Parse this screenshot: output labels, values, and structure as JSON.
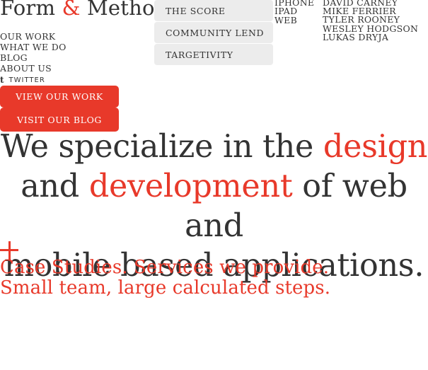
{
  "logo": {
    "part1": "Form ",
    "amp": "&",
    "part2": " Method"
  },
  "nav": {
    "items": [
      "OUR WORK",
      "WHAT WE DO",
      "BLOG",
      "ABOUT US"
    ],
    "twitter_label": "TWITTER",
    "twitter_icon": "twitter-icon"
  },
  "buttons": {
    "work": "VIEW OUR WORK",
    "blog": "VISIT OUR BLOG"
  },
  "projects": [
    "THE SCORE",
    "COMMUNITY LEND",
    "TARGETIVITY"
  ],
  "platforms": [
    "IPHONE",
    "IPAD",
    "WEB"
  ],
  "team": [
    "DAVID CARNEY",
    "MIKE FERRIER",
    "TYLER ROONEY",
    "WESLEY HODGSON",
    "LUKAS DRYJA"
  ],
  "hero": {
    "l1a": "We specialize in the ",
    "l1b": "design",
    "l2a": "and ",
    "l2b": "development",
    "l2c": " of web and",
    "l3": "mobile based applications."
  },
  "taglines": {
    "a": "Case Studies.",
    "b": " Services we provide.",
    "c": "Small team, large calculated steps."
  },
  "colors": {
    "accent": "#e8392a",
    "text": "#333333",
    "tab_bg": "#ececec"
  }
}
